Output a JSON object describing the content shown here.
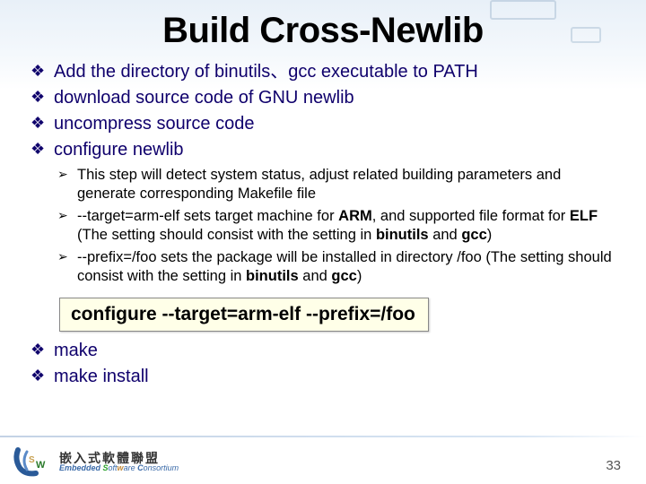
{
  "title": "Build Cross-Newlib",
  "bullets_top": [
    "Add the directory of binutils、gcc executable to PATH",
    "download source code of GNU newlib",
    "uncompress source code",
    "configure newlib"
  ],
  "sub_bullets": {
    "b0": {
      "text": "This step will detect system status, adjust related building parameters and generate corresponding Makefile file"
    },
    "b1": {
      "pre": "--target=arm-elf sets target machine for ",
      "bold1": "ARM",
      "mid": ", and supported file format for ",
      "bold2": "ELF",
      "post1": " (The setting should consist with the setting in ",
      "bold3": "binutils",
      "post2": " and ",
      "bold4": "gcc",
      "post3": ")"
    },
    "b2": {
      "pre": "--prefix=/foo sets the package will be installed in directory /foo (The setting should consist with the setting in ",
      "bold1": "binutils",
      "mid": " and ",
      "bold2": "gcc",
      "post": ")"
    }
  },
  "command": "configure   --target=arm-elf   --prefix=/foo",
  "bullets_bottom": [
    "make",
    "make install"
  ],
  "footer": {
    "cn": "嵌入式軟體聯盟",
    "en_e": "Embedded ",
    "en_s": "S",
    "en_oft": "oft",
    "en_w": "w",
    "en_are": "are ",
    "en_c": "C",
    "en_ons": "onsortium"
  },
  "page": "33"
}
